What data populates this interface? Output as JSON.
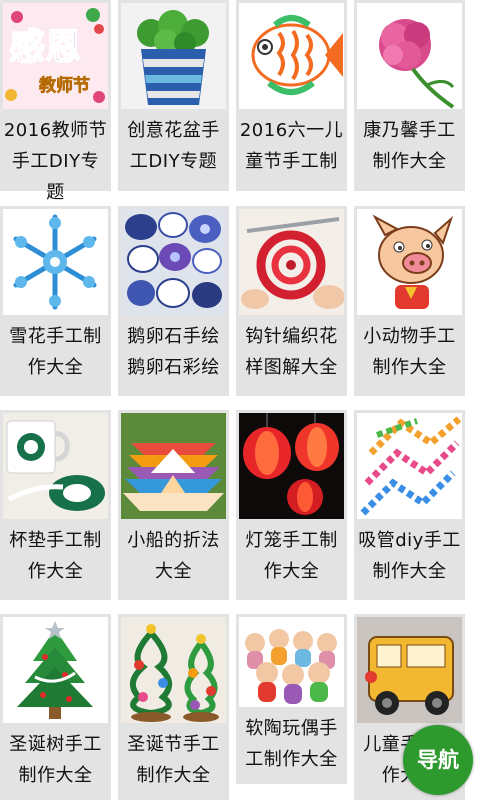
{
  "items": [
    {
      "title": "2016教师节手工DIY专题",
      "image": "teachers-day-card"
    },
    {
      "title": "创意花盆手工DIY专题",
      "image": "flower-pot"
    },
    {
      "title": "2016六一儿童节手工制",
      "image": "paper-fish"
    },
    {
      "title": "康乃馨手工制作大全",
      "image": "carnation-flower"
    },
    {
      "title": "雪花手工制作大全",
      "image": "paper-snowflake"
    },
    {
      "title": "鹅卵石手绘鹅卵石彩绘",
      "image": "painted-pebbles"
    },
    {
      "title": "钩针编织花样图解大全",
      "image": "crochet-hook"
    },
    {
      "title": "小动物手工制作大全",
      "image": "cartoon-pig"
    },
    {
      "title": "杯垫手工制作大全",
      "image": "coffee-cup-coaster"
    },
    {
      "title": "小船的折法大全",
      "image": "origami-boats"
    },
    {
      "title": "灯笼手工制作大全",
      "image": "red-lanterns"
    },
    {
      "title": "吸管diy手工制作大全",
      "image": "straw-craft"
    },
    {
      "title": "圣诞树手工制作大全",
      "image": "christmas-tree"
    },
    {
      "title": "圣诞节手工制作大全",
      "image": "pipe-cleaner-trees"
    },
    {
      "title": "软陶玩偶手工制作大全",
      "image": "clay-dolls"
    },
    {
      "title": "儿童手工制作大全",
      "image": "toy-bus"
    }
  ],
  "thumb_texts": {
    "teachers_day_main": "感恩",
    "teachers_day_sub": "教师节"
  },
  "nav_label": "导航",
  "colors": {
    "card_bg": "#e3e3e3",
    "nav_green": "#2e9a2e",
    "text": "#111111"
  }
}
